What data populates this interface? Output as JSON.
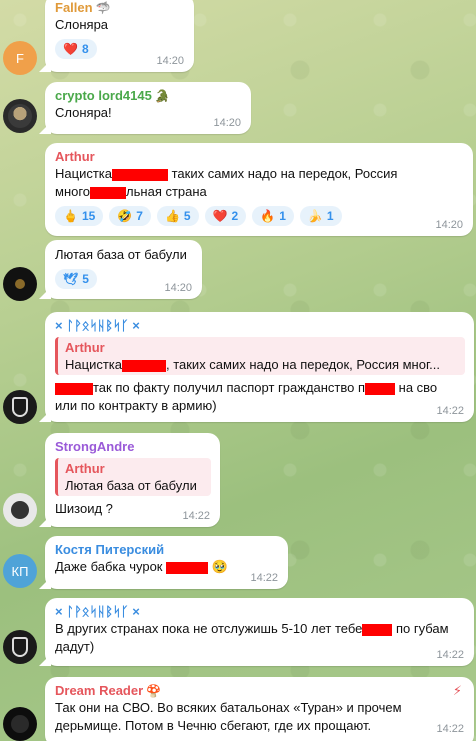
{
  "messages": [
    {
      "name": "Fallen",
      "name_color": "#e09a3a",
      "name_icon": "🦈",
      "text": "Слоняра",
      "reactions": [
        {
          "emoji": "❤️",
          "count": "8"
        }
      ],
      "time": "14:20",
      "avatar_letter": "F",
      "avatar_color": "#f0a04a"
    },
    {
      "name": "crypto lord4145",
      "name_color": "#4aa84a",
      "name_icon": "🐊",
      "text": "Слоняра!",
      "time": "14:20"
    },
    {
      "name": "Arthur",
      "name_color": "#e5565c",
      "text_part1": "Нацистка",
      "text_part2": " таких самих надо на передок, Россия",
      "text_line2a": "много",
      "text_line2b": "льная страна",
      "reactions": [
        {
          "emoji": "🖕",
          "count": "15"
        },
        {
          "emoji": "🤣",
          "count": "7"
        },
        {
          "emoji": "👍",
          "count": "5"
        },
        {
          "emoji": "❤️",
          "count": "2"
        },
        {
          "emoji": "🔥",
          "count": "1"
        },
        {
          "emoji": "🍌",
          "count": "1"
        }
      ],
      "time": "14:20"
    },
    {
      "text": "Лютая база от бабули",
      "reactions": [
        {
          "emoji": "🕊",
          "count": "5"
        }
      ],
      "time": "14:20"
    },
    {
      "name": "× ᛚᚹᛟᛋᚺᛒᛋᚴ ×",
      "name_color": "#3a8de0",
      "quote_name": "Arthur",
      "quote_text_a": "Нацистка",
      "quote_text_b": ", таких самих надо на передок, Россия мног...",
      "text_line1a": "",
      "text_line1b": "так по факту получил паспорт гражданство п",
      "text_line1c": " на сво",
      "text_line2": "или по контракту в армию)",
      "time": "14:22"
    },
    {
      "name": "StrongAndre",
      "name_color": "#9a5ad8",
      "quote_name": "Arthur",
      "quote_text": "Лютая база от бабули",
      "text": "Шизоид ?",
      "time": "14:22"
    },
    {
      "name": "Костя Питерский",
      "name_color": "#3a8de0",
      "text_a": "Даже бабка чурок",
      "text_emoji": "🥹",
      "time": "14:22",
      "avatar_letter": "КП",
      "avatar_color": "#4fa3d8"
    },
    {
      "name": "× ᛚᚹᛟᛋᚺᛒᛋᚴ ×",
      "name_color": "#3a8de0",
      "text_line1a": "В других странах пока не отслужишь 5-10 лет тебе",
      "text_line1b": " по губам",
      "text_line2": "дадут)",
      "time": "14:22"
    },
    {
      "name": "Dream Reader",
      "name_color": "#e5565c",
      "name_icon": "🍄",
      "text_line1": "Так они на СВО. Во всяких батальонах «Туран» и прочем",
      "text_line2": "дерьмище. Потом в Чечню сбегают, где их прощают.",
      "time": "14:22",
      "badge": "⚡"
    }
  ]
}
